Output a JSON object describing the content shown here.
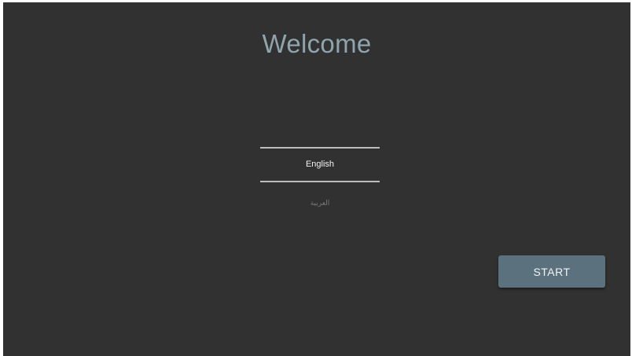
{
  "screen": {
    "title": "Welcome"
  },
  "language_picker": {
    "options": [
      {
        "label": "English",
        "selected": true
      },
      {
        "label": "العربية",
        "selected": false
      }
    ]
  },
  "actions": {
    "start_label": "START"
  },
  "colors": {
    "background": "#313131",
    "title": "#8fa4ad",
    "button": "#5b727e",
    "divider": "#bdbdbd"
  }
}
